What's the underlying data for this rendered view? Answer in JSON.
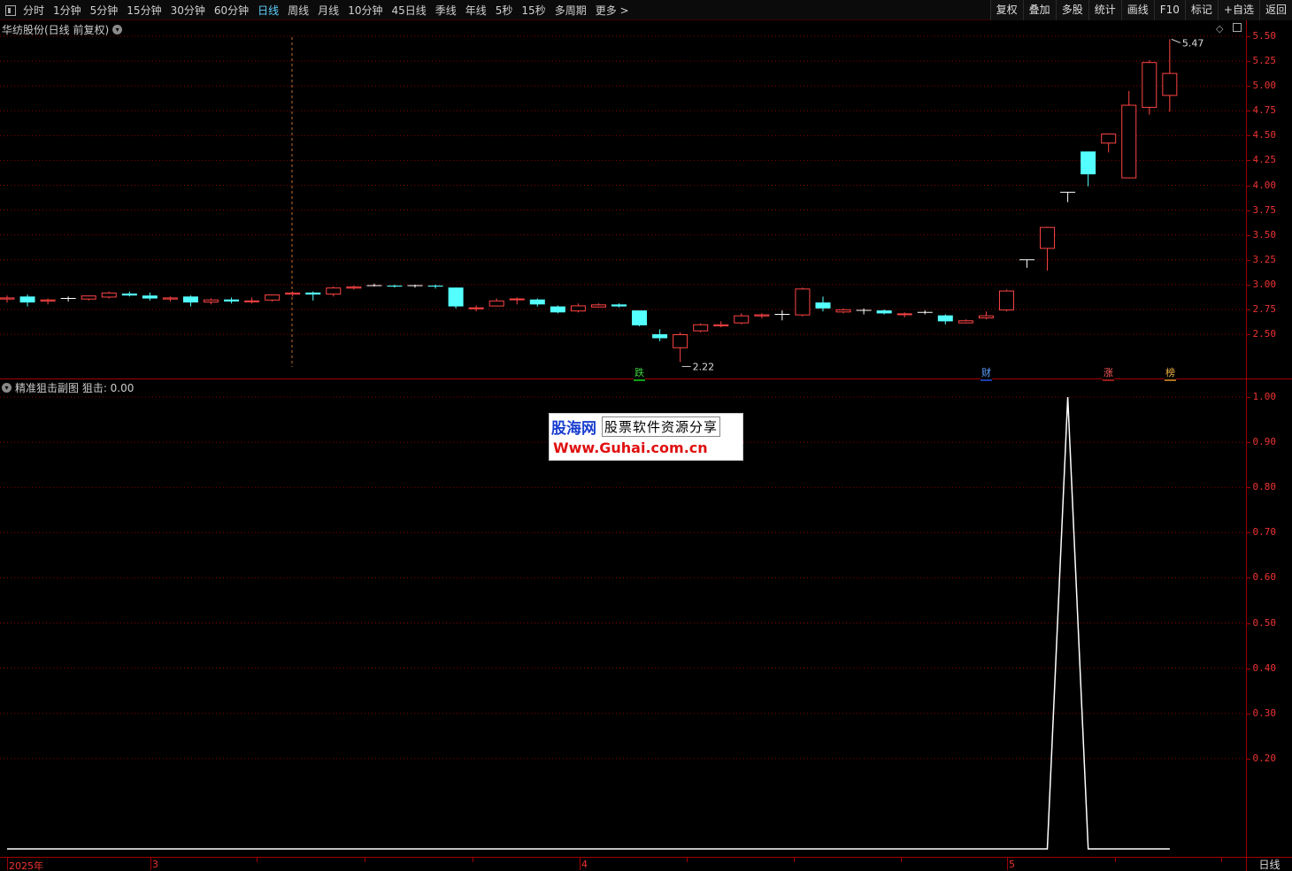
{
  "toolbar": {
    "periods": [
      "分时",
      "1分钟",
      "5分钟",
      "15分钟",
      "30分钟",
      "60分钟",
      "日线",
      "周线",
      "月线",
      "10分钟",
      "45日线",
      "季线",
      "年线",
      "5秒",
      "15秒",
      "多周期",
      "更多 >"
    ],
    "active_period": "日线",
    "right_buttons": [
      "复权",
      "叠加",
      "多股",
      "统计",
      "画线",
      "F10",
      "标记",
      "+自选",
      "返回"
    ]
  },
  "main_panel": {
    "title": "华纺股份(日线 前复权)",
    "y_ticks": [
      "5.50",
      "5.25",
      "5.00",
      "4.75",
      "4.50",
      "4.25",
      "4.00",
      "3.75",
      "3.50",
      "3.25",
      "3.00",
      "2.75",
      "2.50"
    ],
    "high_label": "5.47",
    "low_label": "2.22",
    "tags": [
      "跌",
      "财",
      "涨",
      "榜"
    ]
  },
  "sub_panel": {
    "title": "精准狙击副图 狙击: 0.00",
    "y_ticks": [
      "1.00",
      "0.90",
      "0.80",
      "0.70",
      "0.60",
      "0.50",
      "0.40",
      "0.30",
      "0.20"
    ]
  },
  "x_axis": {
    "labels": [
      "2025年",
      "3",
      "4",
      "5"
    ],
    "period_label": "日线"
  },
  "watermark": {
    "brand": "股海网",
    "tagline": "股票软件资源分享",
    "url": "Www.Guhai.com.cn"
  },
  "colors": {
    "up": "#ff4444",
    "down": "#54ffff",
    "neutral": "#ffffff",
    "grid": "#8b0000",
    "axis": "#a00000"
  },
  "chart_data": {
    "type": "candlestick",
    "candles": [
      {
        "o": 2.85,
        "h": 2.89,
        "l": 2.82,
        "c": 2.87
      },
      {
        "o": 2.88,
        "h": 2.9,
        "l": 2.78,
        "c": 2.82
      },
      {
        "o": 2.83,
        "h": 2.86,
        "l": 2.8,
        "c": 2.85
      },
      {
        "o": 2.86,
        "h": 2.88,
        "l": 2.83,
        "c": 2.86
      },
      {
        "o": 2.85,
        "h": 2.89,
        "l": 2.84,
        "c": 2.89
      },
      {
        "o": 2.87,
        "h": 2.93,
        "l": 2.86,
        "c": 2.92
      },
      {
        "o": 2.91,
        "h": 2.93,
        "l": 2.88,
        "c": 2.89
      },
      {
        "o": 2.89,
        "h": 2.92,
        "l": 2.84,
        "c": 2.86
      },
      {
        "o": 2.85,
        "h": 2.88,
        "l": 2.83,
        "c": 2.87
      },
      {
        "o": 2.88,
        "h": 2.89,
        "l": 2.78,
        "c": 2.82
      },
      {
        "o": 2.82,
        "h": 2.86,
        "l": 2.8,
        "c": 2.85
      },
      {
        "o": 2.85,
        "h": 2.87,
        "l": 2.81,
        "c": 2.83
      },
      {
        "o": 2.83,
        "h": 2.87,
        "l": 2.81,
        "c": 2.84
      },
      {
        "o": 2.84,
        "h": 2.9,
        "l": 2.83,
        "c": 2.9
      },
      {
        "o": 2.9,
        "h": 2.93,
        "l": 2.88,
        "c": 2.92
      },
      {
        "o": 2.92,
        "h": 2.93,
        "l": 2.84,
        "c": 2.9
      },
      {
        "o": 2.9,
        "h": 2.98,
        "l": 2.88,
        "c": 2.97
      },
      {
        "o": 2.96,
        "h": 2.99,
        "l": 2.95,
        "c": 2.98
      },
      {
        "o": 2.99,
        "h": 3.01,
        "l": 2.98,
        "c": 2.99
      },
      {
        "o": 2.99,
        "h": 3.0,
        "l": 2.97,
        "c": 2.98
      },
      {
        "o": 2.99,
        "h": 3.0,
        "l": 2.97,
        "c": 2.99
      },
      {
        "o": 2.99,
        "h": 3.0,
        "l": 2.96,
        "c": 2.98
      },
      {
        "o": 2.97,
        "h": 2.97,
        "l": 2.76,
        "c": 2.78
      },
      {
        "o": 2.76,
        "h": 2.79,
        "l": 2.73,
        "c": 2.77
      },
      {
        "o": 2.78,
        "h": 2.86,
        "l": 2.78,
        "c": 2.84
      },
      {
        "o": 2.85,
        "h": 2.87,
        "l": 2.8,
        "c": 2.86
      },
      {
        "o": 2.85,
        "h": 2.86,
        "l": 2.78,
        "c": 2.8
      },
      {
        "o": 2.78,
        "h": 2.79,
        "l": 2.71,
        "c": 2.72
      },
      {
        "o": 2.73,
        "h": 2.81,
        "l": 2.72,
        "c": 2.79
      },
      {
        "o": 2.77,
        "h": 2.81,
        "l": 2.77,
        "c": 2.8
      },
      {
        "o": 2.8,
        "h": 2.81,
        "l": 2.77,
        "c": 2.78
      },
      {
        "o": 2.74,
        "h": 2.74,
        "l": 2.58,
        "c": 2.59
      },
      {
        "o": 2.5,
        "h": 2.55,
        "l": 2.43,
        "c": 2.46
      },
      {
        "o": 2.36,
        "h": 2.52,
        "l": 2.22,
        "c": 2.5
      },
      {
        "o": 2.53,
        "h": 2.61,
        "l": 2.52,
        "c": 2.6
      },
      {
        "o": 2.58,
        "h": 2.63,
        "l": 2.57,
        "c": 2.6
      },
      {
        "o": 2.61,
        "h": 2.71,
        "l": 2.6,
        "c": 2.69
      },
      {
        "o": 2.68,
        "h": 2.71,
        "l": 2.66,
        "c": 2.7
      },
      {
        "o": 2.7,
        "h": 2.74,
        "l": 2.64,
        "c": 2.7
      },
      {
        "o": 2.69,
        "h": 2.97,
        "l": 2.68,
        "c": 2.96
      },
      {
        "o": 2.82,
        "h": 2.88,
        "l": 2.73,
        "c": 2.76
      },
      {
        "o": 2.72,
        "h": 2.76,
        "l": 2.71,
        "c": 2.75
      },
      {
        "o": 2.74,
        "h": 2.76,
        "l": 2.7,
        "c": 2.74
      },
      {
        "o": 2.74,
        "h": 2.75,
        "l": 2.7,
        "c": 2.71
      },
      {
        "o": 2.7,
        "h": 2.72,
        "l": 2.67,
        "c": 2.71
      },
      {
        "o": 2.72,
        "h": 2.74,
        "l": 2.7,
        "c": 2.72
      },
      {
        "o": 2.69,
        "h": 2.7,
        "l": 2.6,
        "c": 2.63
      },
      {
        "o": 2.61,
        "h": 2.65,
        "l": 2.61,
        "c": 2.64
      },
      {
        "o": 2.66,
        "h": 2.73,
        "l": 2.65,
        "c": 2.69
      },
      {
        "o": 2.74,
        "h": 2.95,
        "l": 2.73,
        "c": 2.94
      },
      {
        "o": 3.25,
        "h": 3.25,
        "l": 3.17,
        "c": 3.25
      },
      {
        "o": 3.36,
        "h": 3.58,
        "l": 3.14,
        "c": 3.58
      },
      {
        "o": 3.93,
        "h": 3.93,
        "l": 3.83,
        "c": 3.93
      },
      {
        "o": 4.34,
        "h": 4.34,
        "l": 3.99,
        "c": 4.11
      },
      {
        "o": 4.42,
        "h": 4.52,
        "l": 4.33,
        "c": 4.52
      },
      {
        "o": 4.07,
        "h": 4.95,
        "l": 4.07,
        "c": 4.81
      },
      {
        "o": 4.78,
        "h": 5.26,
        "l": 4.71,
        "c": 5.24
      },
      {
        "o": 4.9,
        "h": 5.47,
        "l": 4.74,
        "c": 5.13
      }
    ],
    "y_range": [
      2.22,
      5.47
    ],
    "sub_series": [
      0,
      0,
      0,
      0,
      0,
      0,
      0,
      0,
      0,
      0,
      0,
      0,
      0,
      0,
      0,
      0,
      0,
      0,
      0,
      0,
      0,
      0,
      0,
      0,
      0,
      0,
      0,
      0,
      0,
      0,
      0,
      0,
      0,
      0,
      0,
      0,
      0,
      0,
      0,
      0,
      0,
      0,
      0,
      0,
      0,
      0,
      0,
      0,
      0,
      0,
      0,
      0,
      1,
      0,
      0,
      0,
      0,
      0
    ],
    "sub_y_range": [
      0,
      1.0
    ]
  }
}
